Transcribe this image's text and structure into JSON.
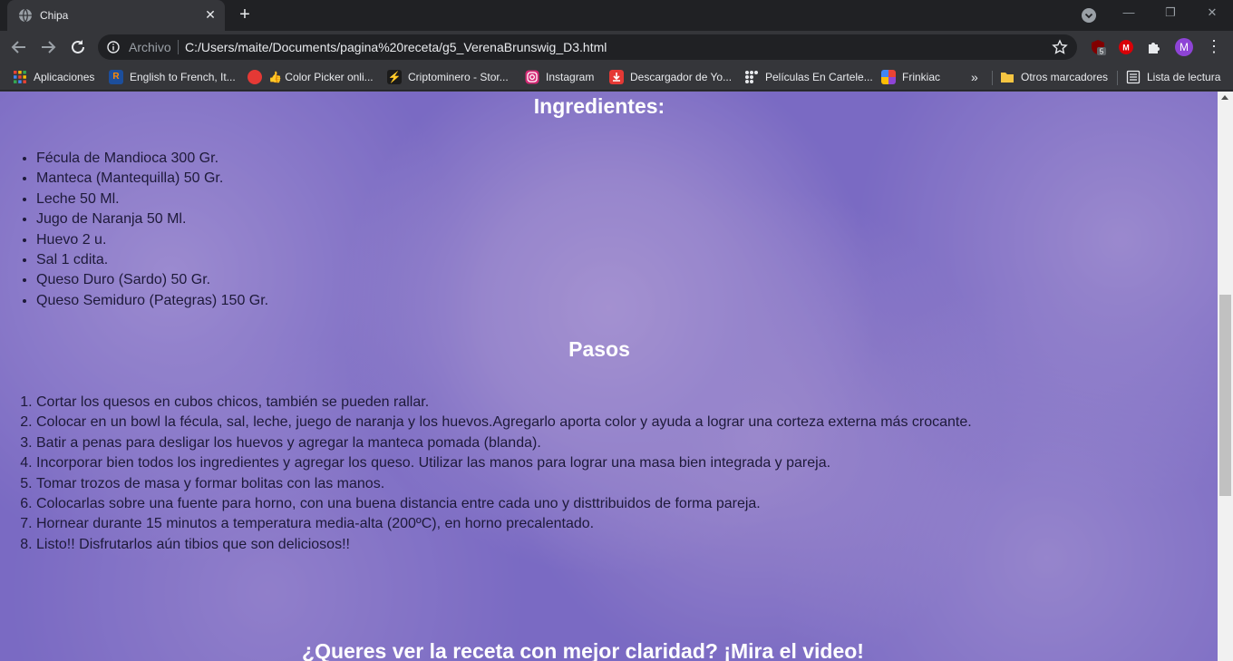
{
  "browser": {
    "tab_title": "Chipa",
    "url_chip": "Archivo",
    "url": "C:/Users/maite/Documents/pagina%20receta/g5_VerenaBrunswig_D3.html",
    "profile_initial": "M",
    "ublock_badge": "5"
  },
  "bookmarks": [
    {
      "label": "Aplicaciones",
      "icon": "apps-grid-icon"
    },
    {
      "label": "English to French, It...",
      "icon": "reverso-icon"
    },
    {
      "label": "👍 Color Picker onli...",
      "icon": "color-picker-icon"
    },
    {
      "label": "Criptominero - Stor...",
      "icon": "criptominero-icon"
    },
    {
      "label": "Instagram",
      "icon": "instagram-icon"
    },
    {
      "label": "Descargador de Yo...",
      "icon": "download-icon"
    },
    {
      "label": "Películas En Cartele...",
      "icon": "movies-icon"
    },
    {
      "label": "Frinkiac",
      "icon": "frinkiac-icon"
    }
  ],
  "bookmarks_overflow": "»",
  "other_bookmarks": "Otros marcadores",
  "reading_list": "Lista de lectura",
  "page": {
    "ingredients_title": "Ingredientes:",
    "ingredients": [
      "Fécula de Mandioca 300 Gr.",
      "Manteca (Mantequilla) 50 Gr.",
      "Leche 50 Ml.",
      "Jugo de Naranja 50 Ml.",
      "Huevo 2 u.",
      "Sal 1 cdita.",
      "Queso Duro (Sardo) 50 Gr.",
      "Queso Semiduro (Pategras) 150 Gr."
    ],
    "steps_title": "Pasos",
    "steps": [
      "Cortar los quesos en cubos chicos, también se pueden rallar.",
      "Colocar en un bowl la fécula, sal, leche, juego de naranja y los huevos.Agregarlo aporta color y ayuda a lograr una corteza externa más crocante.",
      "Batir a penas para desligar los huevos y agregar la manteca pomada (blanda).",
      "Incorporar bien todos los ingredientes y agregar los queso. Utilizar las manos para lograr una masa bien integrada y pareja.",
      "Tomar trozos de masa y formar bolitas con las manos.",
      "Colocarlas sobre una fuente para horno, con una buena distancia entre cada uno y disttribuidos de forma pareja.",
      "Hornear durante 15 minutos a temperatura media-alta (200ºC), en horno precalentado.",
      "Listo!! Disfrutarlos aún tibios que son deliciosos!!"
    ],
    "video_title": "¿Queres ver la receta con mejor claridad? ¡Mira el video!"
  }
}
